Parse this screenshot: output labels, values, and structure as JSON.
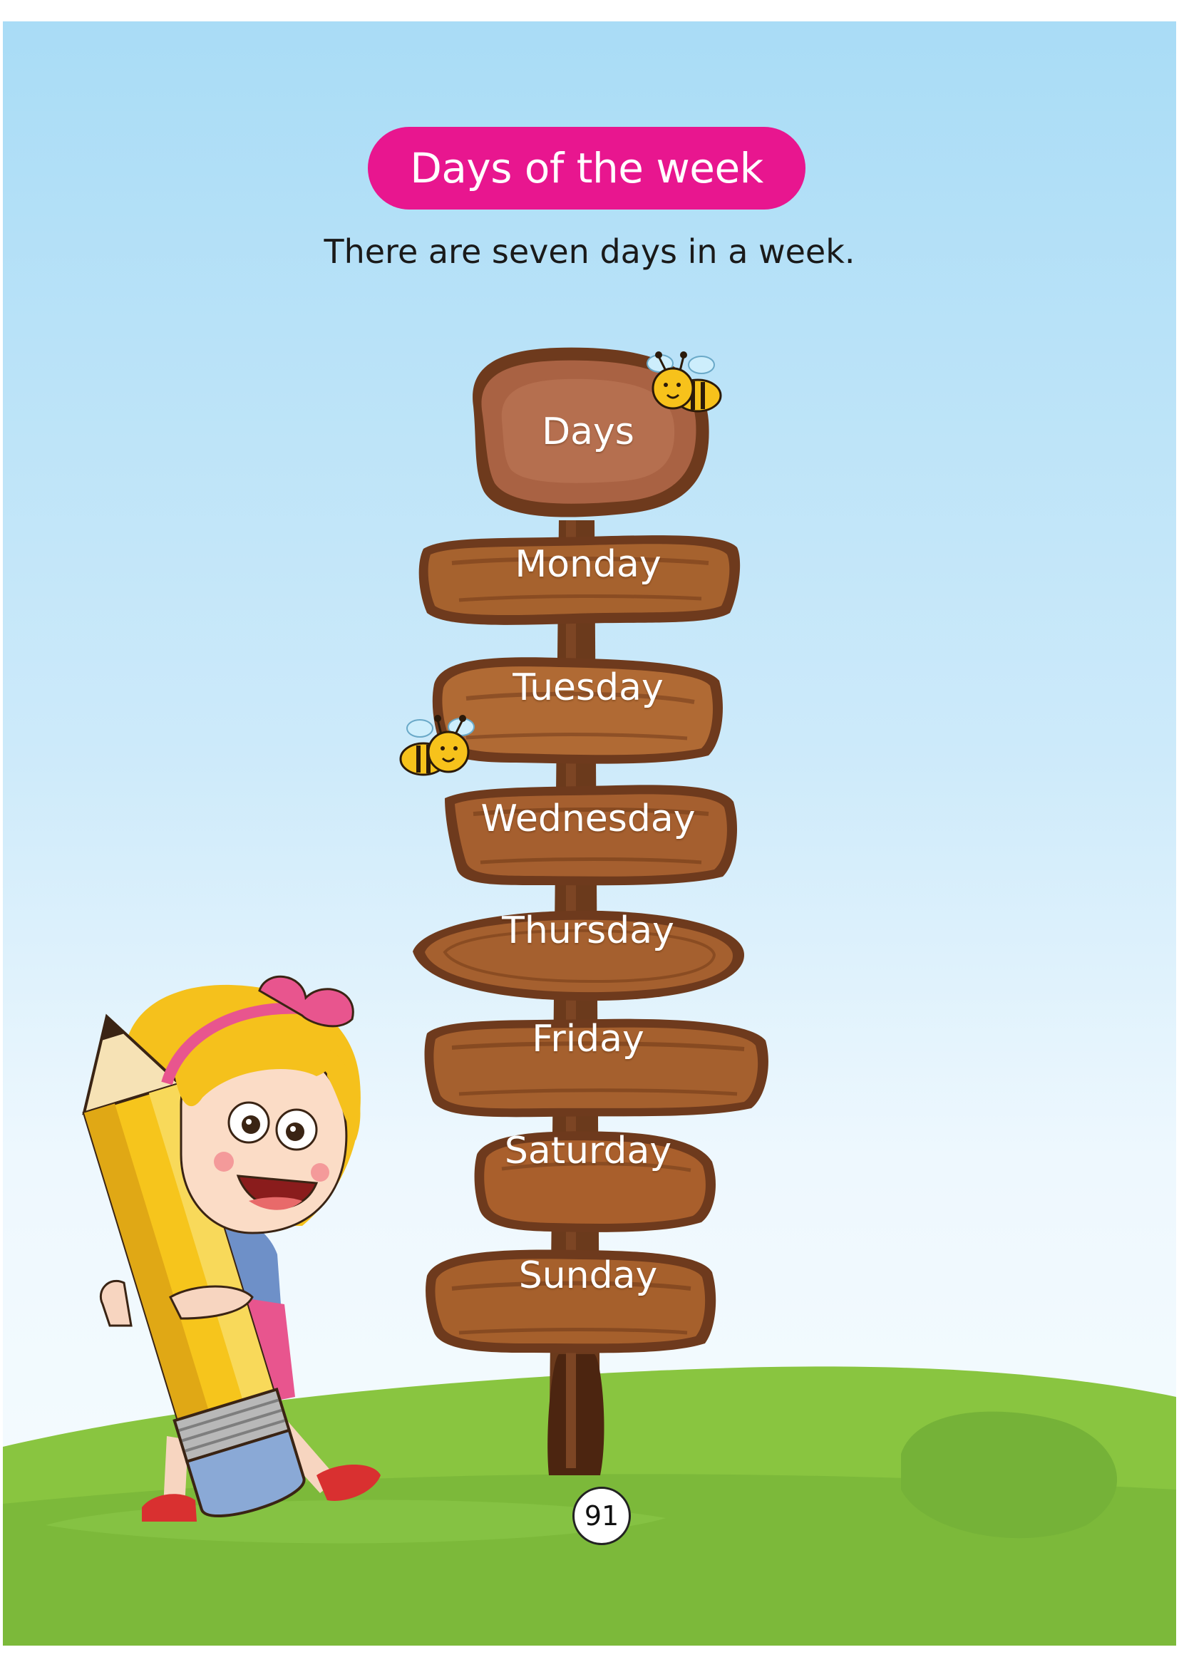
{
  "title": "Days of the week",
  "subtitle": "There are seven days in a week.",
  "signpost": {
    "top_label": "Days",
    "days": [
      "Monday",
      "Tuesday",
      "Wednesday",
      "Thursday",
      "Friday",
      "Saturday",
      "Sunday"
    ]
  },
  "page_number": "91",
  "colors": {
    "title_pill": "#e8168f",
    "wood": "#9c5a2e",
    "grass": "#7cc03c",
    "sky": "#a9dcf6"
  },
  "illustrations": [
    "girl-with-pencil-illustration",
    "bee-icon",
    "signpost-illustration"
  ]
}
